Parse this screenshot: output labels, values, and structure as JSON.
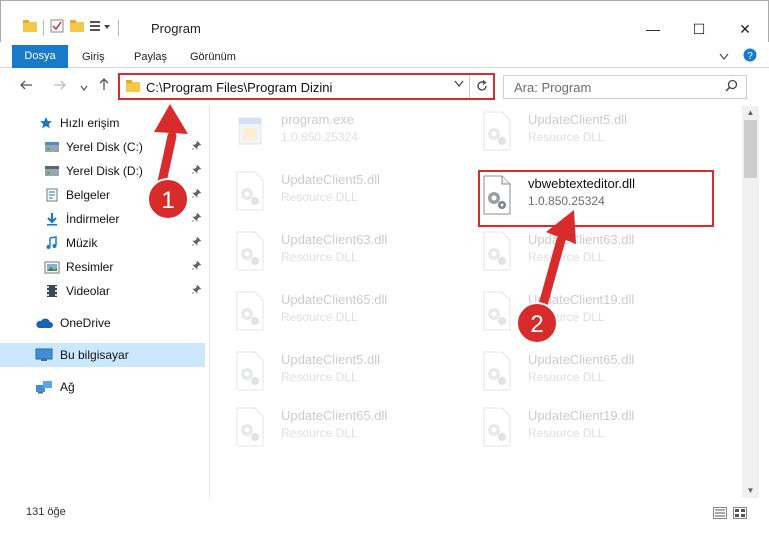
{
  "window": {
    "title": "Program",
    "minimize": "—",
    "maximize": "☐",
    "close": "✕"
  },
  "ribbon": {
    "tabs": [
      "Dosya",
      "Giriş",
      "Paylaş",
      "Görünüm"
    ]
  },
  "nav": {
    "address": "C:\\Program Files\\Program Dizini",
    "search_placeholder": "Ara: Program"
  },
  "sidebar": {
    "items": [
      {
        "label": "Hızlı erişim",
        "icon": "star-icon",
        "pinned": false
      },
      {
        "label": "Yerel Disk (C:)",
        "icon": "drive-icon",
        "pinned": true
      },
      {
        "label": "Yerel Disk (D:)",
        "icon": "drive-icon",
        "pinned": true
      },
      {
        "label": "Belgeler",
        "icon": "documents-icon",
        "pinned": true
      },
      {
        "label": "İndirmeler",
        "icon": "download-icon",
        "pinned": true
      },
      {
        "label": "Müzik",
        "icon": "music-icon",
        "pinned": true
      },
      {
        "label": "Resimler",
        "icon": "pictures-icon",
        "pinned": true
      },
      {
        "label": "Videolar",
        "icon": "videos-icon",
        "pinned": true
      },
      {
        "label": "OneDrive",
        "icon": "cloud-icon",
        "pinned": false
      },
      {
        "label": "Bu bilgisayar",
        "icon": "computer-icon",
        "pinned": false,
        "selected": true
      },
      {
        "label": "Ağ",
        "icon": "network-icon",
        "pinned": false
      }
    ]
  },
  "files": [
    {
      "name": "program.exe",
      "sub": "1.0.850.25324",
      "faded": true,
      "type": "exe"
    },
    {
      "name": "UpdateClient5.dll",
      "sub": "Resource DLL",
      "faded": true,
      "type": "dll"
    },
    {
      "name": "UpdateClient5.dll",
      "sub": "Resource DLL",
      "faded": true,
      "type": "dll"
    },
    {
      "name": "vbwebtexteditor.dll",
      "sub": "1.0.850.25324",
      "faded": false,
      "type": "dll"
    },
    {
      "name": "UpdateClient63.dll",
      "sub": "Resource DLL",
      "faded": true,
      "type": "dll"
    },
    {
      "name": "UpdateClient63.dll",
      "sub": "Resource DLL",
      "faded": true,
      "type": "dll"
    },
    {
      "name": "UpdateClient65.dll",
      "sub": "Resource DLL",
      "faded": true,
      "type": "dll"
    },
    {
      "name": "UpdateClient19.dll",
      "sub": "Resource DLL",
      "faded": true,
      "type": "dll"
    },
    {
      "name": "UpdateClient5.dll",
      "sub": "Resource DLL",
      "faded": true,
      "type": "dll"
    },
    {
      "name": "UpdateClient65.dll",
      "sub": "Resource DLL",
      "faded": true,
      "type": "dll"
    },
    {
      "name": "UpdateClient65.dll",
      "sub": "Resource DLL",
      "faded": true,
      "type": "dll"
    },
    {
      "name": "UpdateClient19.dll",
      "sub": "Resource DLL",
      "faded": true,
      "type": "dll"
    }
  ],
  "status": {
    "count": "131 öğe"
  },
  "annotations": [
    {
      "number": "1",
      "color": "#d82c2c"
    },
    {
      "number": "2",
      "color": "#d82c2c"
    }
  ]
}
